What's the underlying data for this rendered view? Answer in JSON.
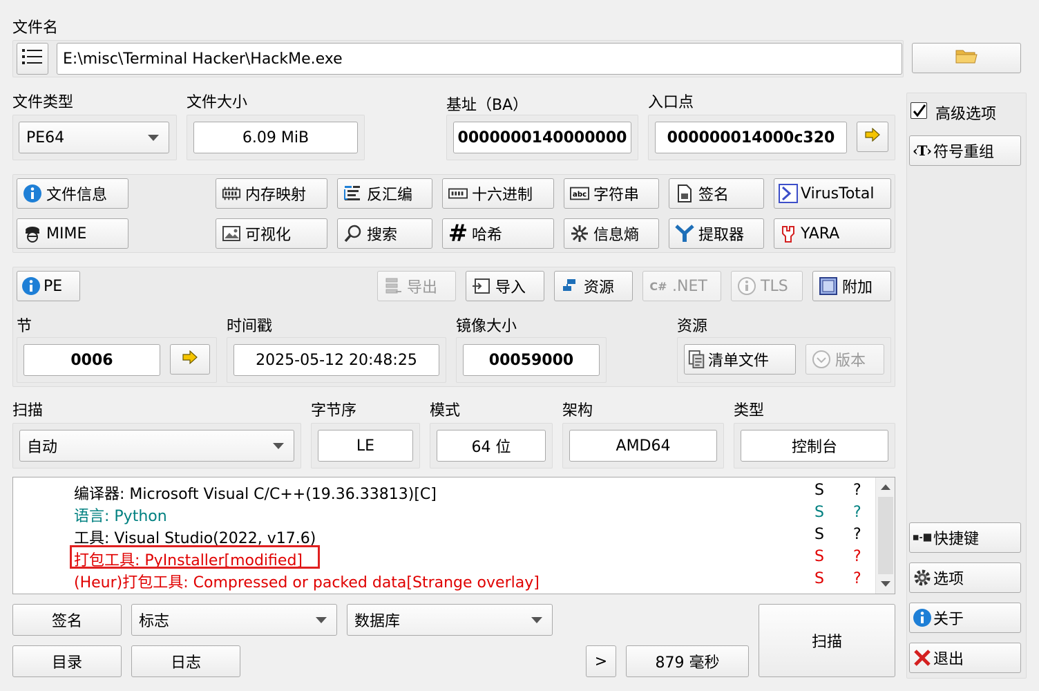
{
  "file": {
    "label": "文件名",
    "path": "E:\\misc\\Terminal Hacker\\HackMe.exe"
  },
  "info": {
    "type_label": "文件类型",
    "type_value": "PE64",
    "size_label": "文件大小",
    "size_value": "6.09 MiB",
    "base_label": "基址（BA）",
    "base_value": "0000000140000000",
    "entry_label": "入口点",
    "entry_value": "000000014000c320"
  },
  "right_panel": {
    "advanced_label": "高级选项",
    "advanced_checked": true,
    "symbol_label": "符号重组",
    "shortcut_label": "快捷键",
    "options_label": "选项",
    "about_label": "关于",
    "exit_label": "退出"
  },
  "tools": {
    "file_info": "文件信息",
    "mime": "MIME",
    "memory_map": "内存映射",
    "disasm": "反汇编",
    "hex": "十六进制",
    "strings": "字符串",
    "signature": "签名",
    "virustotal": "VirusTotal",
    "visualize": "可视化",
    "search": "搜索",
    "hash": "哈希",
    "entropy": "信息熵",
    "extractor": "提取器",
    "yara": "YARA"
  },
  "pe": {
    "pe_label": "PE",
    "export_label": "导出",
    "import_label": "导入",
    "resources_label": "资源",
    "dotnet_label": ".NET",
    "tls_label": "TLS",
    "overlay_label": "附加",
    "sections_label": "节",
    "sections_value": "0006",
    "timestamp_label": "时间戳",
    "timestamp_value": "2025-05-12 20:48:25",
    "image_size_label": "镜像大小",
    "image_size_value": "00059000",
    "resource_label": "资源",
    "manifest_label": "清单文件",
    "version_label": "版本"
  },
  "scan": {
    "scan_label": "扫描",
    "scan_mode": "自动",
    "endian_label": "字节序",
    "endian_value": "LE",
    "mode_label": "模式",
    "mode_value": "64 位",
    "arch_label": "架构",
    "arch_value": "AMD64",
    "type_label": "类型",
    "type_value": "控制台"
  },
  "results": [
    {
      "text": "编译器: Microsoft Visual C/C++(19.36.33813)[C]",
      "s": "S",
      "q": "?",
      "color": "#000000"
    },
    {
      "text": "语言: Python",
      "s": "S",
      "q": "?",
      "color": "#008080"
    },
    {
      "text": "工具: Visual Studio(2022, v17.6)",
      "s": "S",
      "q": "?",
      "color": "#000000"
    },
    {
      "text": "打包工具: PyInstaller[modified]",
      "s": "S",
      "q": "?",
      "color": "#e00000",
      "highlighted": true
    },
    {
      "text": "(Heur)打包工具: Compressed or packed data[Strange overlay]",
      "s": "S",
      "q": "?",
      "color": "#e00000"
    }
  ],
  "bottom": {
    "signatures_label": "签名",
    "flags_value": "标志",
    "database_value": "数据库",
    "directory_label": "目录",
    "log_label": "日志",
    "more_label": ">",
    "elapsed": "879 毫秒",
    "scan_button": "扫描"
  },
  "colors": {
    "window_bg": "#f0f0f0",
    "highlight_box": "#e02020",
    "red_text": "#e00000",
    "teal_text": "#008080",
    "info_blue": "#1e7fd6",
    "arrow_yellow": "#f5c400"
  }
}
